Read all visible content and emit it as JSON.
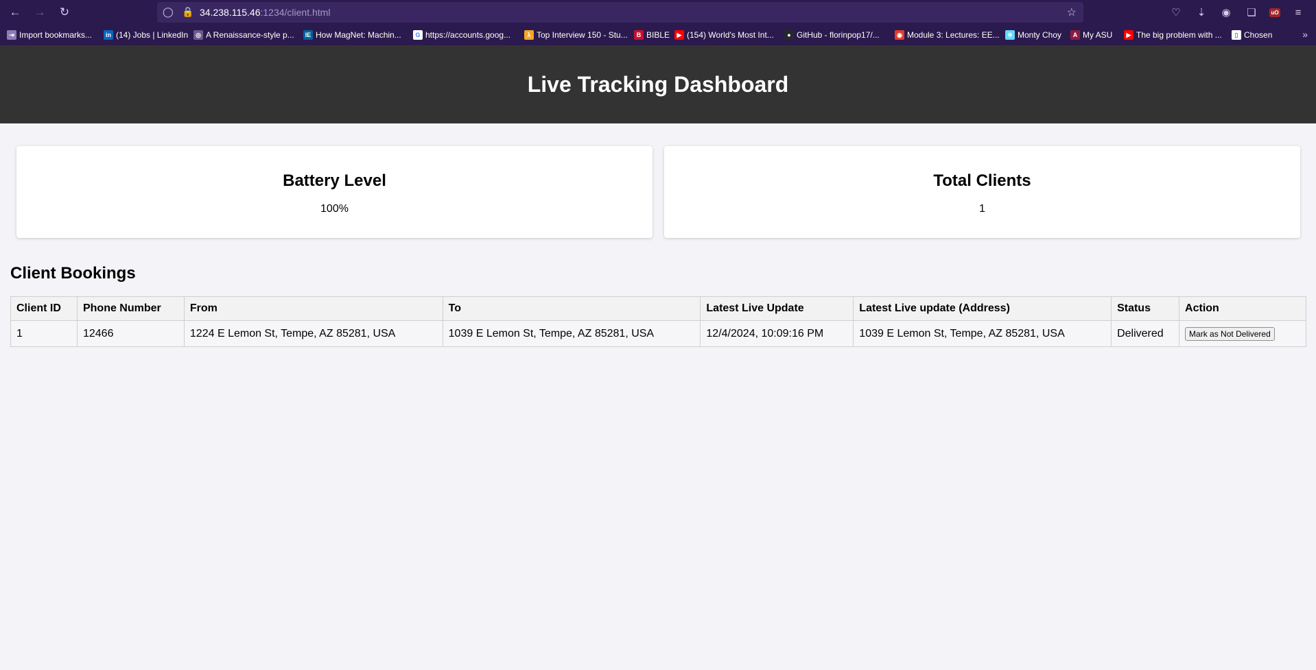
{
  "browser": {
    "url_host": "34.238.115.46",
    "url_path": ":1234/client.html",
    "bookmarks": [
      {
        "label": "Import bookmarks...",
        "icon": "import-icon",
        "color": "#8b7bb8"
      },
      {
        "label": "(14) Jobs | LinkedIn",
        "icon": "linkedin-icon",
        "color": "#0a66c2"
      },
      {
        "label": "A Renaissance-style p...",
        "icon": "globe-icon",
        "color": "#6b5a8e"
      },
      {
        "label": "How MagNet: Machin...",
        "icon": "ieee-icon",
        "color": "#00629b"
      },
      {
        "label": "https://accounts.goog...",
        "icon": "google-icon",
        "color": "#ffffff"
      },
      {
        "label": "Top Interview 150 - Stu...",
        "icon": "leetcode-icon",
        "color": "#f5a623"
      },
      {
        "label": "BIBLE",
        "icon": "bible-icon",
        "color": "#c8102e"
      },
      {
        "label": "(154) World's Most Int...",
        "icon": "youtube-icon",
        "color": "#ff0000"
      },
      {
        "label": "GitHub - florinpop17/...",
        "icon": "github-icon",
        "color": "#24292e"
      },
      {
        "label": "Module 3: Lectures: EE...",
        "icon": "canvas-icon",
        "color": "#e23c2d"
      },
      {
        "label": "Monty Choy",
        "icon": "react-icon",
        "color": "#61dafb"
      },
      {
        "label": "My ASU",
        "icon": "asu-icon",
        "color": "#8c1d40"
      },
      {
        "label": "The big problem with ...",
        "icon": "youtube-icon",
        "color": "#ff0000"
      },
      {
        "label": "Chosen",
        "icon": "chosen-icon",
        "color": "#ffffff"
      }
    ]
  },
  "header": {
    "title": "Live Tracking Dashboard"
  },
  "cards": {
    "battery": {
      "title": "Battery Level",
      "value": "100%"
    },
    "clients": {
      "title": "Total Clients",
      "value": "1"
    }
  },
  "bookings": {
    "title": "Client Bookings",
    "columns": [
      "Client ID",
      "Phone Number",
      "From",
      "To",
      "Latest Live Update",
      "Latest Live update (Address)",
      "Status",
      "Action"
    ],
    "rows": [
      {
        "client_id": "1",
        "phone": "12466",
        "from": "1224 E Lemon St, Tempe, AZ 85281, USA",
        "to": "1039 E Lemon St, Tempe, AZ 85281, USA",
        "latest_update": "12/4/2024, 10:09:16 PM",
        "latest_address": "1039 E Lemon St, Tempe, AZ 85281, USA",
        "status": "Delivered",
        "action_label": "Mark as Not Delivered"
      }
    ]
  },
  "colors": {
    "chrome_bg": "#2b1a4d",
    "header_bg": "#333333",
    "page_bg": "#f4f4f8"
  }
}
